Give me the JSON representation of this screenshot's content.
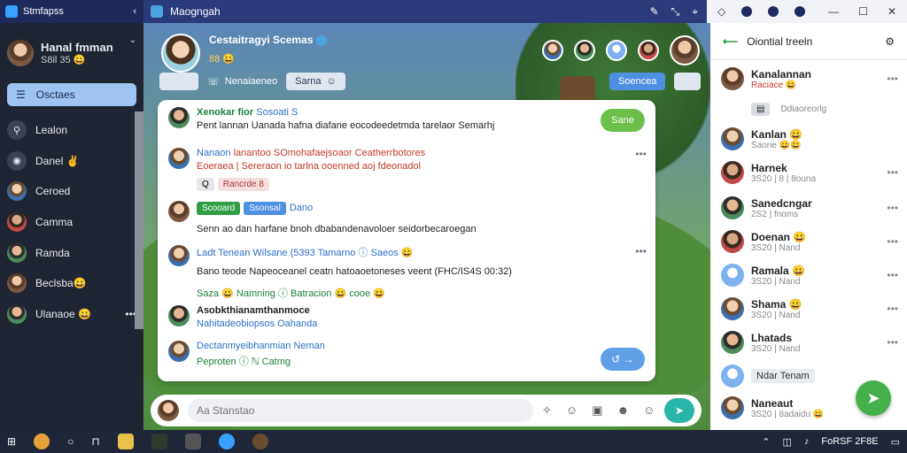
{
  "titlebar": {
    "app_title": "Stmfapss",
    "window_title": "Maogngah",
    "right_title": "",
    "icons": [
      "pencil-icon",
      "collapse-icon",
      "pin-icon"
    ]
  },
  "sidebar": {
    "profile": {
      "name": "Hanal fmman",
      "sub": "S8il 35 😀"
    },
    "active_label": "Osctaes",
    "items": [
      {
        "label": "Lealon"
      },
      {
        "label": "Danel ✌"
      },
      {
        "label": "Ceroed"
      },
      {
        "label": "Camma"
      },
      {
        "label": "Ramda"
      },
      {
        "label": "Beclsba😀"
      },
      {
        "label": "Ulanaoe 😀"
      }
    ]
  },
  "chat_header": {
    "name": "Cestaitragyi Scemas",
    "sub": "88 😀",
    "pill1": "",
    "pill2": "Nenaiaeneo",
    "pill3": "Sarna",
    "pill4": "Soencea"
  },
  "messages": [
    {
      "author": "Xenokar fior",
      "tag": "Sosoati S",
      "text": "Pent lannan Uanada hafna diafane eocodeedetmda tarelaor Semarhj",
      "action": "Sane"
    },
    {
      "author": "Nanaon",
      "tag": "lanantoo SOmohafaejsoaor Ceatherrbotores",
      "text": "Eoeraea | Sereraon io tarlna ooenned aoj fdeonadol",
      "chip": "Rancrde 8"
    },
    {
      "author": "",
      "chip1": "Scooard",
      "chip2": "Ssonsal",
      "tag": "Dano",
      "text": "Senn ao dan harfane bnoh dbabandenavoloer seidorbecaroegan"
    },
    {
      "author": "Ladt Tenean",
      "tag": "Wilsane (5393 Tamarno ⓘ Saeos 😀",
      "text": "Bano teode  Napeoceanel ceatn hatoaoetoneses veent (FHC/IS4S 00:32)",
      "line3": "Saza 😀 Namning ⓘ Batracion 😀 cooe 😀"
    },
    {
      "author": "Asobkthianamthanmoce",
      "tag": "Nahitadeobiopsos Oahanda"
    },
    {
      "author": "Dectanmyeibhanmian Neman",
      "tag": "Peproten ⓘ ℕ Catmg",
      "action": "↺ →"
    }
  ],
  "composer": {
    "placeholder": "Aa Stanstao"
  },
  "right_panel": {
    "title": "Oiontial treeln",
    "items": [
      {
        "name": "Kanalannan",
        "status": "Raciace 😀"
      },
      {
        "name": "",
        "status": "Ddiaoreorlg"
      },
      {
        "name": "Kanlan 😀",
        "status": "Saone 😀😀"
      },
      {
        "name": "Harnek",
        "status": "3S20 | 8 | 8ouna"
      },
      {
        "name": "Sanedcngar",
        "status": "2S2 | fnoms"
      },
      {
        "name": "Doenan 😀",
        "status": "3S20 | Nand"
      },
      {
        "name": "Ramala 😀",
        "status": "3S20 | Nand"
      },
      {
        "name": "Shama 😀",
        "status": "3S20 | Nand"
      },
      {
        "name": "Lhatads",
        "status": "3S20 | Nand"
      },
      {
        "name": "Ndar Tenam",
        "status": ""
      },
      {
        "name": "Naneaut",
        "status": "3S20 | 8adaidu 😀"
      }
    ]
  },
  "taskbar": {
    "tray_text": "FoRSF 2F8E"
  }
}
